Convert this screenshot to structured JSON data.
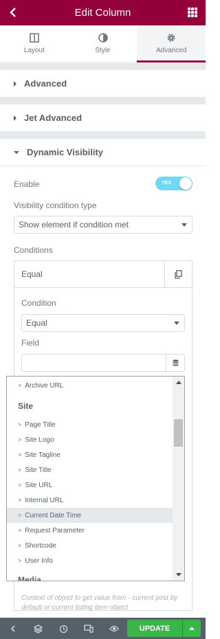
{
  "header": {
    "title": "Edit Column"
  },
  "tabs": [
    {
      "label": "Layout",
      "icon": "layout-icon"
    },
    {
      "label": "Style",
      "icon": "style-icon"
    },
    {
      "label": "Advanced",
      "icon": "gear-icon",
      "active": true
    }
  ],
  "sections": {
    "advanced": "Advanced",
    "jet_advanced": "Jet Advanced",
    "dynamic_visibility": "Dynamic Visibility"
  },
  "dynamic_visibility": {
    "enable_label": "Enable",
    "enable_toggle_text": "YES",
    "condition_type_label": "Visibility condition type",
    "condition_type_value": "Show element if condition met",
    "conditions_label": "Conditions",
    "condition_item_title": "Equal",
    "condition_label": "Condition",
    "condition_value": "Equal",
    "field_label": "Field",
    "field_value": "",
    "help_text": "Context of object to get value from - current post by default or current listing item object"
  },
  "dropdown": {
    "items_before": [
      "Archive URL"
    ],
    "group_site": "Site",
    "site_items": [
      "Page Title",
      "Site Logo",
      "Site Tagline",
      "Site Title",
      "Site URL",
      "Internal URL",
      "Current Date Time",
      "Request Parameter",
      "Shortcode",
      "User Info"
    ],
    "highlighted": "Current Date Time",
    "group_media": "Media"
  },
  "footer": {
    "update_label": "UPDATE"
  },
  "colors": {
    "brand": "#93003c",
    "toggle": "#71d7f7",
    "update": "#39b54a",
    "footer": "#556068"
  }
}
